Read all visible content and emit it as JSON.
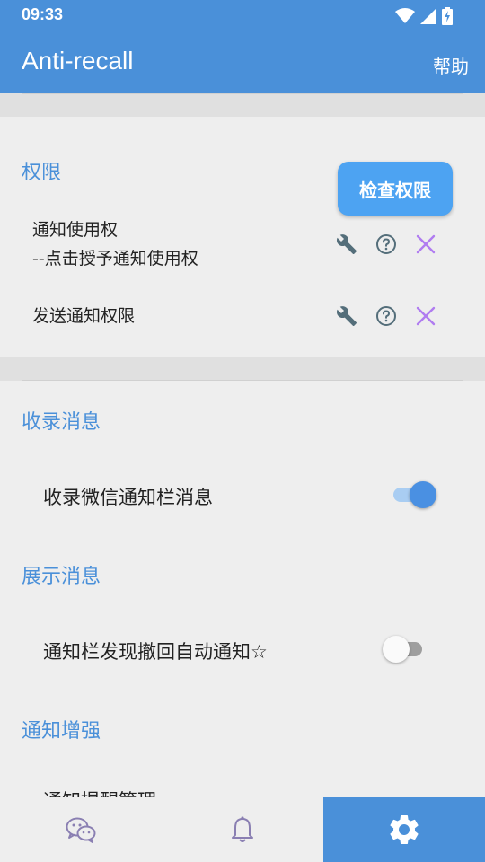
{
  "status_bar": {
    "time": "09:33",
    "icons": [
      "wifi-icon",
      "signal-icon",
      "battery-charging-icon"
    ]
  },
  "app_bar": {
    "title": "Anti-recall",
    "help_label": "帮助"
  },
  "permissions": {
    "title": "权限",
    "check_button": "检查权限",
    "rows": [
      {
        "label_line1": "通知使用权",
        "label_line2": "--点击授予通知使用权",
        "icons": [
          "wrench-icon",
          "help-circle-icon",
          "close-icon"
        ]
      },
      {
        "label_line1": "发送通知权限",
        "icons": [
          "wrench-icon",
          "help-circle-icon",
          "close-icon"
        ]
      }
    ]
  },
  "sections": {
    "record": {
      "title": "收录消息",
      "setting": {
        "label": "收录微信通知栏消息",
        "toggle_state": "on"
      }
    },
    "display": {
      "title": "展示消息",
      "setting": {
        "label": "通知栏发现撤回自动通知☆",
        "toggle_state": "off"
      }
    },
    "enhance": {
      "title": "通知增强",
      "setting": {
        "label": "通知提醒管理"
      }
    }
  },
  "bottom_nav": {
    "items": [
      {
        "icon": "chat-icon",
        "active": false
      },
      {
        "icon": "bell-icon",
        "active": false
      },
      {
        "icon": "gear-icon",
        "active": true
      }
    ]
  },
  "colors": {
    "primary": "#4a90d9",
    "button": "#4da3f2",
    "toggle_on": "#4a90e2",
    "close_icon": "#b07cf0",
    "icon_gray": "#546e7a"
  }
}
